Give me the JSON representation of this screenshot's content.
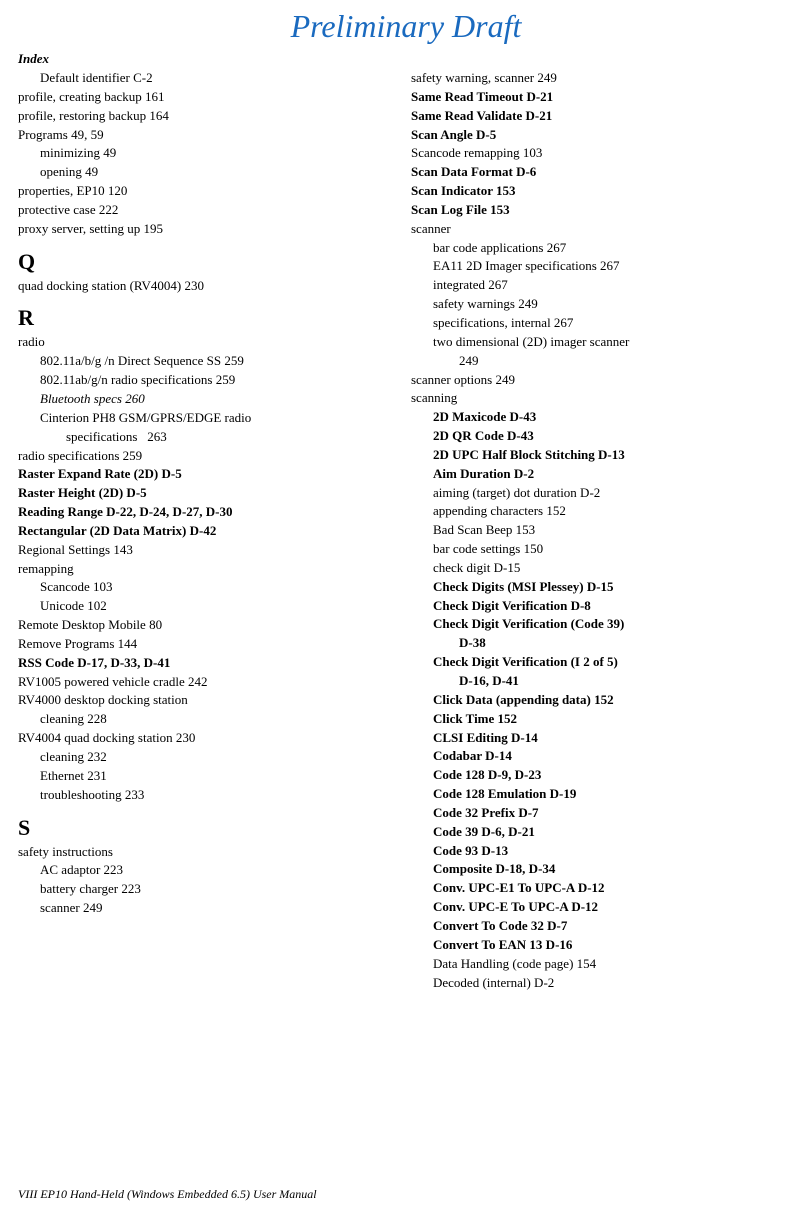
{
  "title": "Preliminary Draft",
  "index_label": "Index",
  "left_col": [
    {
      "text": "Default identifier   C-2",
      "indent": 1,
      "bold": false
    },
    {
      "text": "profile, creating backup   161",
      "indent": 0,
      "bold": false
    },
    {
      "text": "profile, restoring backup   164",
      "indent": 0,
      "bold": false
    },
    {
      "text": "Programs   49, 59",
      "indent": 0,
      "bold": false
    },
    {
      "text": "minimizing   49",
      "indent": 1,
      "bold": false
    },
    {
      "text": "opening   49",
      "indent": 1,
      "bold": false
    },
    {
      "text": "properties, EP10   120",
      "indent": 0,
      "bold": false
    },
    {
      "text": "protective case   222",
      "indent": 0,
      "bold": false
    },
    {
      "text": "proxy server, setting up   195",
      "indent": 0,
      "bold": false
    },
    {
      "section": "Q"
    },
    {
      "text": "quad docking station (RV4004)   230",
      "indent": 0,
      "bold": false
    },
    {
      "section": "R"
    },
    {
      "text": "radio",
      "indent": 0,
      "bold": false
    },
    {
      "text": "802.11a/b/g /n Direct Sequence SS   259",
      "indent": 1,
      "bold": false
    },
    {
      "text": "802.11ab/g/n radio specifications   259",
      "indent": 1,
      "bold": false
    },
    {
      "text": "Bluetooth specs   260",
      "indent": 1,
      "bold": false,
      "italic": true
    },
    {
      "text": "Cinterion PH8 GSM/GPRS/EDGE radio specifications   263",
      "indent": 1,
      "bold": false,
      "wrap": true
    },
    {
      "text": "radio specifications   259",
      "indent": 0,
      "bold": false
    },
    {
      "text": "Raster Expand Rate (2D)   D-5",
      "indent": 0,
      "bold": true
    },
    {
      "text": "Raster Height (2D)   D-5",
      "indent": 0,
      "bold": true
    },
    {
      "text": "Reading Range   D-22, D-24, D-27, D-30",
      "indent": 0,
      "bold": true
    },
    {
      "text": "Rectangular (2D Data Matrix)   D-42",
      "indent": 0,
      "bold": true
    },
    {
      "text": "Regional Settings   143",
      "indent": 0,
      "bold": false
    },
    {
      "text": "remapping",
      "indent": 0,
      "bold": false
    },
    {
      "text": "Scancode   103",
      "indent": 1,
      "bold": false
    },
    {
      "text": "Unicode   102",
      "indent": 1,
      "bold": false
    },
    {
      "text": "Remote Desktop Mobile   80",
      "indent": 0,
      "bold": false
    },
    {
      "text": "Remove Programs   144",
      "indent": 0,
      "bold": false
    },
    {
      "text": "RSS Code   D-17, D-33, D-41",
      "indent": 0,
      "bold": true
    },
    {
      "text": "RV1005 powered vehicle cradle   242",
      "indent": 0,
      "bold": false
    },
    {
      "text": "RV4000 desktop docking station",
      "indent": 0,
      "bold": false
    },
    {
      "text": "cleaning   228",
      "indent": 1,
      "bold": false
    },
    {
      "text": "RV4004 quad docking station   230",
      "indent": 0,
      "bold": false
    },
    {
      "text": "cleaning   232",
      "indent": 1,
      "bold": false
    },
    {
      "text": "Ethernet   231",
      "indent": 1,
      "bold": false
    },
    {
      "text": "troubleshooting   233",
      "indent": 1,
      "bold": false
    },
    {
      "section": "S"
    },
    {
      "text": "safety instructions",
      "indent": 0,
      "bold": false
    },
    {
      "text": "AC adaptor   223",
      "indent": 1,
      "bold": false
    },
    {
      "text": "battery charger   223",
      "indent": 1,
      "bold": false
    },
    {
      "text": "scanner   249",
      "indent": 1,
      "bold": false
    }
  ],
  "right_col": [
    {
      "text": "safety warning, scanner   249",
      "indent": 0,
      "bold": false
    },
    {
      "text": "Same Read Timeout   D-21",
      "indent": 0,
      "bold": true
    },
    {
      "text": "Same Read Validate   D-21",
      "indent": 0,
      "bold": true
    },
    {
      "text": "Scan Angle   D-5",
      "indent": 0,
      "bold": true
    },
    {
      "text": "Scancode remapping   103",
      "indent": 0,
      "bold": false
    },
    {
      "text": "Scan Data Format   D-6",
      "indent": 0,
      "bold": true
    },
    {
      "text": "Scan Indicator   153",
      "indent": 0,
      "bold": true
    },
    {
      "text": "Scan Log File   153",
      "indent": 0,
      "bold": true
    },
    {
      "text": "scanner",
      "indent": 0,
      "bold": false
    },
    {
      "text": "bar code applications   267",
      "indent": 1,
      "bold": false
    },
    {
      "text": "EA11 2D Imager specifications   267",
      "indent": 1,
      "bold": false
    },
    {
      "text": "integrated   267",
      "indent": 1,
      "bold": false
    },
    {
      "text": "safety warnings   249",
      "indent": 1,
      "bold": false
    },
    {
      "text": "specifications, internal   267",
      "indent": 1,
      "bold": false
    },
    {
      "text": "two dimensional (2D) imager scanner   249",
      "indent": 1,
      "bold": false,
      "wrap2": true
    },
    {
      "text": "scanner options   249",
      "indent": 0,
      "bold": false
    },
    {
      "text": "scanning",
      "indent": 0,
      "bold": false
    },
    {
      "text": "2D Maxicode   D-43",
      "indent": 1,
      "bold": true
    },
    {
      "text": "2D QR Code   D-43",
      "indent": 1,
      "bold": true
    },
    {
      "text": "2D UPC Half Block Stitching   D-13",
      "indent": 1,
      "bold": true
    },
    {
      "text": "Aim Duration   D-2",
      "indent": 1,
      "bold": true
    },
    {
      "text": "aiming (target) dot duration   D-2",
      "indent": 1,
      "bold": false
    },
    {
      "text": "appending characters   152",
      "indent": 1,
      "bold": false
    },
    {
      "text": "Bad Scan Beep   153",
      "indent": 1,
      "bold": false
    },
    {
      "text": "bar code settings   150",
      "indent": 1,
      "bold": false
    },
    {
      "text": "check digit   D-15",
      "indent": 1,
      "bold": false
    },
    {
      "text": "Check Digits (MSI Plessey)   D-15",
      "indent": 1,
      "bold": true
    },
    {
      "text": "Check Digit Verification   D-8",
      "indent": 1,
      "bold": true
    },
    {
      "text": "Check Digit Verification (Code 39)   D-38",
      "indent": 1,
      "bold": true,
      "wrap3": true
    },
    {
      "text": "Check Digit Verification (I 2 of 5)   D-16, D-41",
      "indent": 1,
      "bold": true,
      "wrap3": true
    },
    {
      "text": "Click Data (appending data)   152",
      "indent": 1,
      "bold": true
    },
    {
      "text": "Click Time   152",
      "indent": 1,
      "bold": true
    },
    {
      "text": "CLSI Editing   D-14",
      "indent": 1,
      "bold": true
    },
    {
      "text": "Codabar   D-14",
      "indent": 1,
      "bold": true
    },
    {
      "text": "Code 128   D-9, D-23",
      "indent": 1,
      "bold": true
    },
    {
      "text": "Code 128 Emulation   D-19",
      "indent": 1,
      "bold": true
    },
    {
      "text": "Code 32 Prefix   D-7",
      "indent": 1,
      "bold": true
    },
    {
      "text": "Code 39   D-6, D-21",
      "indent": 1,
      "bold": true
    },
    {
      "text": "Code 93   D-13",
      "indent": 1,
      "bold": true
    },
    {
      "text": "Composite   D-18, D-34",
      "indent": 1,
      "bold": true
    },
    {
      "text": "Conv. UPC-E1 To UPC-A   D-12",
      "indent": 1,
      "bold": true
    },
    {
      "text": "Conv. UPC-E To UPC-A   D-12",
      "indent": 1,
      "bold": true
    },
    {
      "text": "Convert To Code 32   D-7",
      "indent": 1,
      "bold": true
    },
    {
      "text": "Convert To EAN 13   D-16",
      "indent": 1,
      "bold": true
    },
    {
      "text": "Data Handling (code page)   154",
      "indent": 1,
      "bold": false
    },
    {
      "text": "Decoded (internal)   D-2",
      "indent": 1,
      "bold": false
    }
  ],
  "footer": {
    "left": "VIII      EP10 Hand-Held (Windows Embedded 6.5) User Manual",
    "right": ""
  }
}
